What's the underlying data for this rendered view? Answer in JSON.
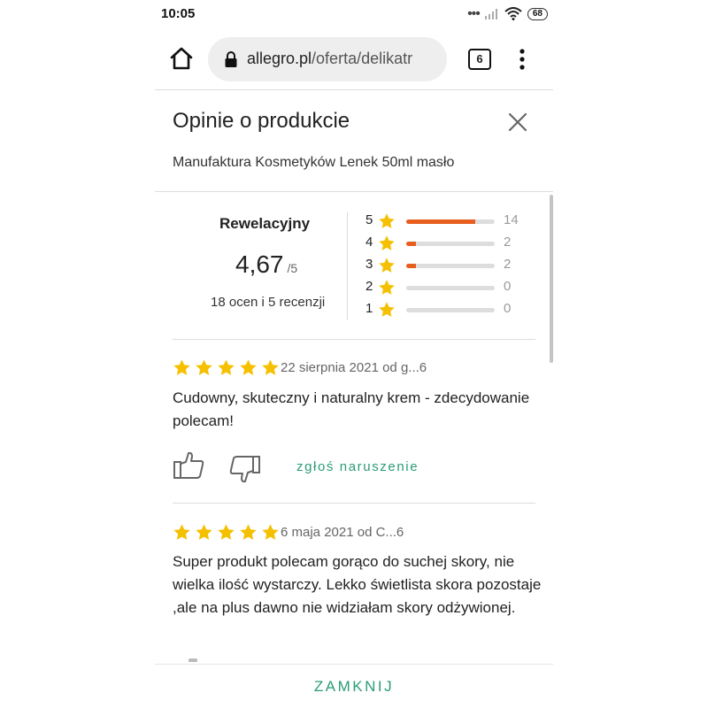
{
  "status_bar": {
    "time": "10:05",
    "signal_dots": "•••",
    "battery": "68"
  },
  "browser": {
    "url_host": "allegro.pl",
    "url_path": "/oferta/delikatr",
    "tab_count": "6"
  },
  "modal": {
    "title": "Opinie o produkcie",
    "product_name": "Manufaktura Kosmetyków Lenek 50ml masło",
    "close_label": "ZAMKNIJ"
  },
  "summary": {
    "label": "Rewelacyjny",
    "score": "4,67",
    "max": "/5",
    "count_text": "18 ocen i 5 recenzji",
    "distribution": [
      {
        "stars": "5",
        "count": "14",
        "fraction": 0.78
      },
      {
        "stars": "4",
        "count": "2",
        "fraction": 0.11
      },
      {
        "stars": "3",
        "count": "2",
        "fraction": 0.11
      },
      {
        "stars": "2",
        "count": "0",
        "fraction": 0
      },
      {
        "stars": "1",
        "count": "0",
        "fraction": 0
      }
    ]
  },
  "reviews": [
    {
      "rating": 5,
      "meta": "22 sierpnia 2021 od g...6",
      "text": "Cudowny, skuteczny i naturalny krem - zdecydowanie polecam!"
    },
    {
      "rating": 5,
      "meta": "6 maja 2021 od C...6",
      "text": "Super produkt polecam gorąco do suchej skory, nie wielka ilość wystarczy. Lekko świetlista skora pozostaje ,ale na plus dawno nie widziałam skory odżywionej."
    }
  ],
  "actions": {
    "report_label": "zgłoś naruszenie"
  },
  "colors": {
    "star": "#f5c000",
    "bar_fill": "#e75e1e",
    "bar_track": "#dddddd",
    "accent": "#2a9d77"
  },
  "icons": {
    "home": "home-icon",
    "lock": "lock-icon",
    "tabs": "tabs-icon",
    "menu": "menu-icon",
    "close": "close-icon",
    "star": "star-icon",
    "thumb_up": "thumb-up-icon",
    "thumb_down": "thumb-down-icon"
  }
}
